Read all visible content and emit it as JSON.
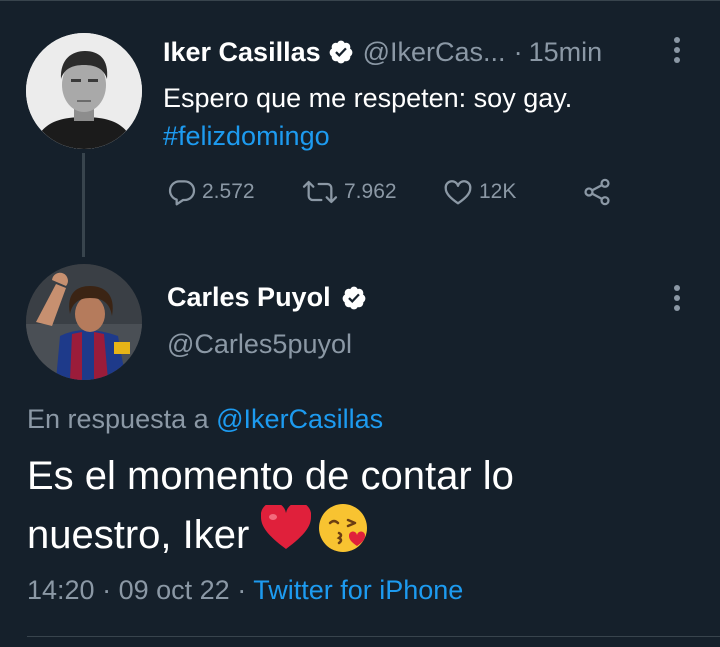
{
  "tweet1": {
    "name": "Iker Casillas",
    "handle": "@IkerCas...",
    "separator": "·",
    "time": "15min",
    "text": "Espero que me respeten: soy gay.",
    "hashtag": "#felizdomingo",
    "actions": {
      "replies": "2.572",
      "retweets": "7.962",
      "likes": "12K"
    },
    "icons": [
      "verified-badge-icon",
      "more-vertical-icon",
      "reply-icon",
      "retweet-icon",
      "like-icon",
      "share-icon"
    ]
  },
  "tweet2": {
    "name": "Carles Puyol",
    "handle": "@Carles5puyol",
    "reply_prefix": "En respuesta a",
    "reply_mention": "@IkerCasillas",
    "text_line1": "Es el momento de contar lo",
    "text_line2": "nuestro, Iker",
    "emojis": [
      "red-heart-emoji",
      "face-blowing-kiss-emoji"
    ],
    "time": "14:20",
    "sep1": "·",
    "date": "09 oct 22",
    "sep2": "·",
    "client": "Twitter for iPhone"
  },
  "colors": {
    "background": "#15202b",
    "text": "#ffffff",
    "muted": "#8b98a5",
    "accent": "#1d9bf0",
    "divider": "#38444d"
  }
}
